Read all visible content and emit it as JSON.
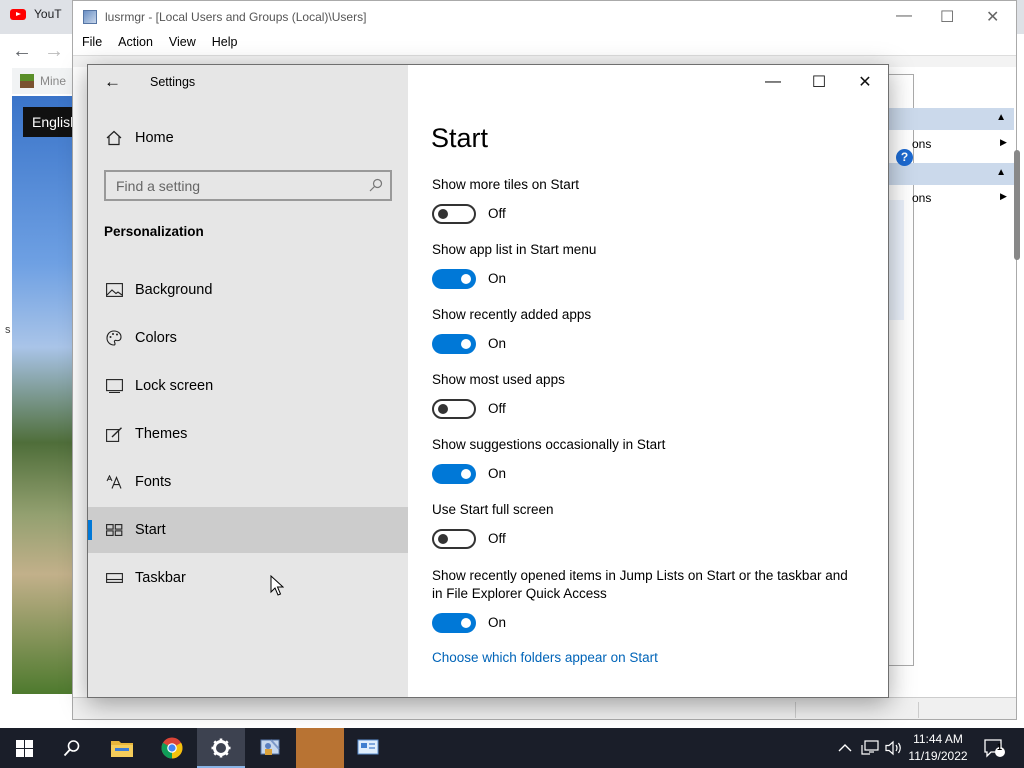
{
  "browser": {
    "tab_title": "YouT",
    "minecraft_tab": "Mine",
    "lang_chip": "English",
    "edge_letter": "s",
    "back_glyph": "←",
    "forward_glyph": "→"
  },
  "lusrmgr": {
    "title": "lusrmgr - [Local Users and Groups (Local)\\Users]",
    "menu": [
      "File",
      "Action",
      "View",
      "Help"
    ],
    "actions_item": "ons",
    "help_glyph": "?"
  },
  "settings": {
    "app_title": "Settings",
    "home_label": "Home",
    "search_placeholder": "Find a setting",
    "section": "Personalization",
    "nav": [
      {
        "label": "Background",
        "icon": "image-icon"
      },
      {
        "label": "Colors",
        "icon": "palette-icon"
      },
      {
        "label": "Lock screen",
        "icon": "lock-screen-icon"
      },
      {
        "label": "Themes",
        "icon": "themes-icon"
      },
      {
        "label": "Fonts",
        "icon": "fonts-icon"
      },
      {
        "label": "Start",
        "icon": "start-icon",
        "active": true
      },
      {
        "label": "Taskbar",
        "icon": "taskbar-icon"
      }
    ],
    "page_title": "Start",
    "options": [
      {
        "label": "Show more tiles on Start",
        "state": "Off",
        "on": false
      },
      {
        "label": "Show app list in Start menu",
        "state": "On",
        "on": true
      },
      {
        "label": "Show recently added apps",
        "state": "On",
        "on": true
      },
      {
        "label": "Show most used apps",
        "state": "Off",
        "on": false
      },
      {
        "label": "Show suggestions occasionally in Start",
        "state": "On",
        "on": true
      },
      {
        "label": "Use Start full screen",
        "state": "Off",
        "on": false
      },
      {
        "label": "Show recently opened items in Jump Lists on Start or the taskbar and in File Explorer Quick Access",
        "state": "On",
        "on": true
      }
    ],
    "link": "Choose which folders appear on Start",
    "accent_color": "#0078d7",
    "link_color": "#0064b8"
  },
  "taskbar": {
    "time": "11:44 AM",
    "date": "11/19/2022",
    "notification_count": "1",
    "apps": [
      "start-icon",
      "search-icon",
      "file-explorer-icon",
      "chrome-icon",
      "settings-gear-icon",
      "lusrmgr-icon",
      "minecraft-icon",
      "control-panel-icon"
    ]
  }
}
